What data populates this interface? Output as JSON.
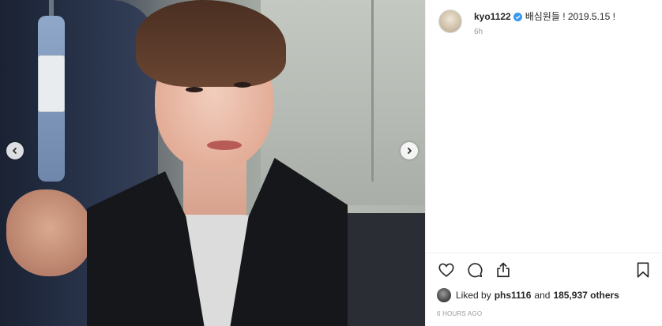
{
  "photo": {
    "nav_prev": "chevron-left-icon",
    "nav_next": "chevron-right-icon"
  },
  "caption": {
    "username": "kyo1122",
    "text": "배심원들 ! 2019.5.15 !",
    "time_ago": "6h"
  },
  "actions": {
    "like_icon": "heart-icon",
    "comment_icon": "comment-icon",
    "share_icon": "share-icon",
    "save_icon": "bookmark-icon"
  },
  "likes": {
    "prefix": "Liked by",
    "user": "phs1116",
    "connector": "and",
    "count_text": "185,937 others"
  },
  "post_time": "6 HOURS AGO",
  "colors": {
    "verified": "#3897f0",
    "text": "#262626",
    "muted": "#999999"
  }
}
